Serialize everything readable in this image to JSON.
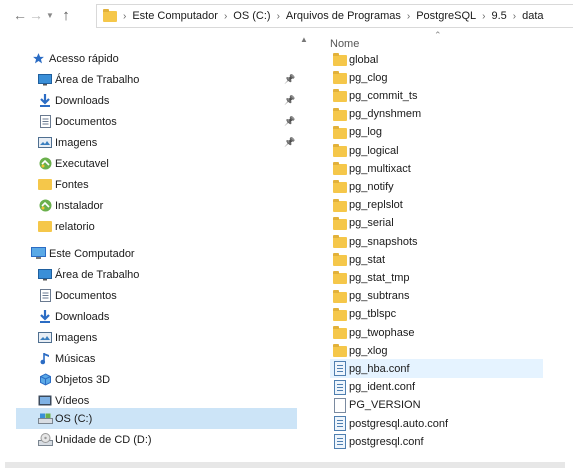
{
  "window": {
    "address": {
      "crumbs": [
        "Este Computador",
        "OS (C:)",
        "Arquivos de Programas",
        "PostgreSQL",
        "9.5",
        "data"
      ]
    }
  },
  "nav": {
    "items": [
      {
        "label": "Acesso rápido",
        "icon": "star-icon",
        "pinned": false
      },
      {
        "label": "Área de Trabalho",
        "icon": "desktop-icon",
        "pinned": true
      },
      {
        "label": "Downloads",
        "icon": "download-arrow-icon",
        "pinned": true
      },
      {
        "label": "Documentos",
        "icon": "documents-icon",
        "pinned": true
      },
      {
        "label": "Imagens",
        "icon": "images-icon",
        "pinned": true
      },
      {
        "label": "Executavel",
        "icon": "app-icon",
        "pinned": false
      },
      {
        "label": "Fontes",
        "icon": "folder-icon",
        "pinned": false
      },
      {
        "label": "Instalador",
        "icon": "app-icon",
        "pinned": false
      },
      {
        "label": "relatorio",
        "icon": "folder-icon",
        "pinned": false
      },
      {
        "label": "Este Computador",
        "icon": "computer-icon",
        "pinned": false
      },
      {
        "label": "Área de Trabalho",
        "icon": "desktop-icon",
        "pinned": false
      },
      {
        "label": "Documentos",
        "icon": "documents-icon",
        "pinned": false
      },
      {
        "label": "Downloads",
        "icon": "download-arrow-icon",
        "pinned": false
      },
      {
        "label": "Imagens",
        "icon": "images-icon",
        "pinned": false
      },
      {
        "label": "Músicas",
        "icon": "music-note-icon",
        "pinned": false
      },
      {
        "label": "Objetos 3D",
        "icon": "cube-icon",
        "pinned": false
      },
      {
        "label": "Vídeos",
        "icon": "video-icon",
        "pinned": false
      },
      {
        "label": "OS (C:)",
        "icon": "drive-icon",
        "pinned": false,
        "selected": true
      },
      {
        "label": "Unidade de CD (D:)",
        "icon": "cd-drive-icon",
        "pinned": false
      }
    ]
  },
  "files": {
    "column_name": "Nome",
    "items": [
      {
        "name": "global",
        "type": "folder"
      },
      {
        "name": "pg_clog",
        "type": "folder"
      },
      {
        "name": "pg_commit_ts",
        "type": "folder"
      },
      {
        "name": "pg_dynshmem",
        "type": "folder"
      },
      {
        "name": "pg_log",
        "type": "folder"
      },
      {
        "name": "pg_logical",
        "type": "folder"
      },
      {
        "name": "pg_multixact",
        "type": "folder"
      },
      {
        "name": "pg_notify",
        "type": "folder"
      },
      {
        "name": "pg_replslot",
        "type": "folder"
      },
      {
        "name": "pg_serial",
        "type": "folder"
      },
      {
        "name": "pg_snapshots",
        "type": "folder"
      },
      {
        "name": "pg_stat",
        "type": "folder"
      },
      {
        "name": "pg_stat_tmp",
        "type": "folder"
      },
      {
        "name": "pg_subtrans",
        "type": "folder"
      },
      {
        "name": "pg_tblspc",
        "type": "folder"
      },
      {
        "name": "pg_twophase",
        "type": "folder"
      },
      {
        "name": "pg_xlog",
        "type": "folder"
      },
      {
        "name": "pg_hba.conf",
        "type": "conf",
        "hover": true
      },
      {
        "name": "pg_ident.conf",
        "type": "conf"
      },
      {
        "name": "PG_VERSION",
        "type": "file"
      },
      {
        "name": "postgresql.auto.conf",
        "type": "conf"
      },
      {
        "name": "postgresql.conf",
        "type": "conf"
      }
    ]
  },
  "colors": {
    "selection": "#cce4f7",
    "hover": "#e5f3ff",
    "folder": "#f5c74a",
    "accent_blue": "#2b6cc4"
  }
}
